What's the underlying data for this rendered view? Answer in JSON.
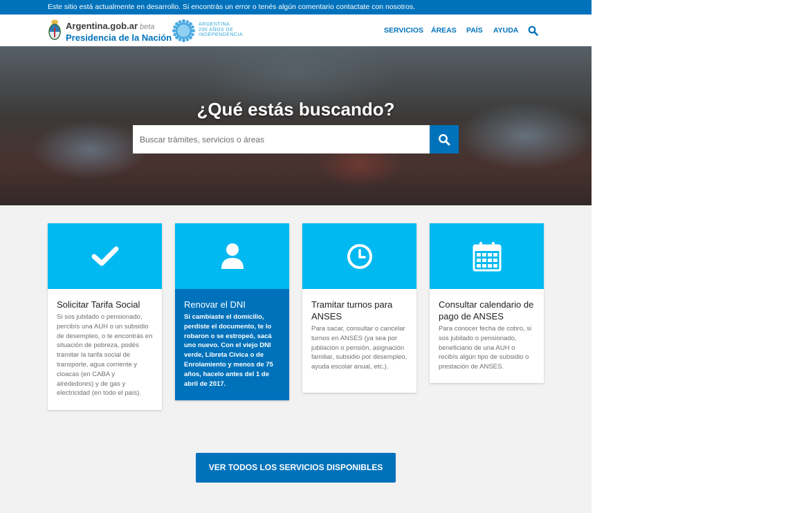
{
  "notice": {
    "text": "Este sitio está actualmente en desarrollo. Si encontrás un error o tenés algún comentario contactate con nosotros."
  },
  "header": {
    "brand": "Argentina.gob.ar",
    "beta": "beta",
    "sub": "Presidencia de la Nación",
    "bicentenario": [
      "ARGENTINA",
      "200 AÑOS DE",
      "INDEPENDENCIA"
    ],
    "nav": [
      "SERVICIOS",
      "ÁREAS",
      "PAÍS",
      "AYUDA"
    ]
  },
  "hero": {
    "title": "¿Qué estás buscando?",
    "search_placeholder": "Buscar trámites, servicios o áreas"
  },
  "cards": [
    {
      "icon": "check-icon",
      "title": "Solicitar Tarifa Social",
      "desc": "Si sos jubilado o pensionado, percibís una AUH o un subsidio de desempleo, o te encontrás en situación de pobreza, podés tramitar la tarifa social de transporte, agua corriente y cloacas (en CABA y alrededores) y de gas y electricidad (en todo el país)."
    },
    {
      "icon": "user-icon",
      "title": "Renovar el DNI",
      "desc": "Si cambiaste el domicilio, perdiste el documento, te lo robaron o se estropeó, sacá uno nuevo. Con el viejo DNI verde, Libreta Cívica o de Enrolamiento y menos de 75 años, hacelo antes del 1 de abril de 2017."
    },
    {
      "icon": "clock-icon",
      "title": "Tramitar turnos para ANSES",
      "desc": "Para sacar, consultar o cancelar turnos en ANSES (ya sea por jubilación o pensión, asignación familiar, subsidio por desempleo, ayuda escolar anual, etc.)."
    },
    {
      "icon": "calendar-icon",
      "title": "Consultar calendario de pago de ANSES",
      "desc": "Para conocer fecha de cobro, si sos jubilado o pensionado, beneficiario de una AUH o recibís algún tipo de subsidio o prestación de ANSES."
    }
  ],
  "cta": {
    "label": "VER TODOS LOS SERVICIOS DISPONIBLES"
  },
  "colors": {
    "primary": "#0072bb",
    "card_header": "#00b9f1",
    "background": "#f2f2f2"
  }
}
